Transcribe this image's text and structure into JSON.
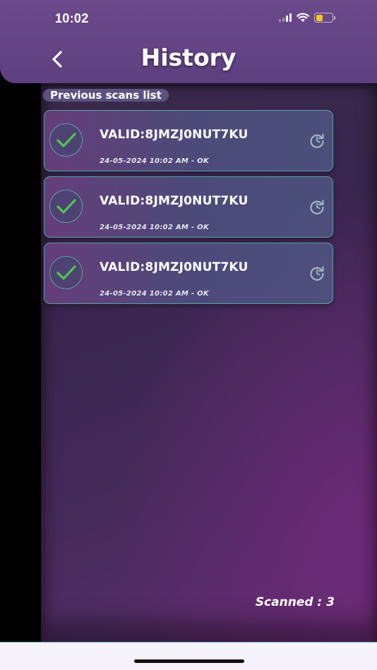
{
  "status_bar": {
    "time": "10:02",
    "battery_level": 0.45,
    "battery_color": "#f4c81c"
  },
  "header": {
    "title": "History",
    "back_icon": "chevron-left-icon"
  },
  "section": {
    "label": "Previous scans list"
  },
  "scans": [
    {
      "code": "VALID:8JMZJ0NUT7KU",
      "meta": "24-05-2024 10:02 AM - OK",
      "status_icon": "check-icon",
      "action_icon": "rescan-icon"
    },
    {
      "code": "VALID:8JMZJ0NUT7KU",
      "meta": "24-05-2024 10:02 AM - OK",
      "status_icon": "check-icon",
      "action_icon": "rescan-icon"
    },
    {
      "code": "VALID:8JMZJ0NUT7KU",
      "meta": "24-05-2024 10:02 AM - OK",
      "status_icon": "check-icon",
      "action_icon": "rescan-icon"
    }
  ],
  "footer": {
    "scanned_label": "Scanned : ",
    "scanned_count": "3"
  },
  "colors": {
    "header_bg": "#6a4a8a",
    "card_border": "#5aa0a8",
    "check_green": "#4fc04f",
    "label_bg": "#5c5280"
  }
}
